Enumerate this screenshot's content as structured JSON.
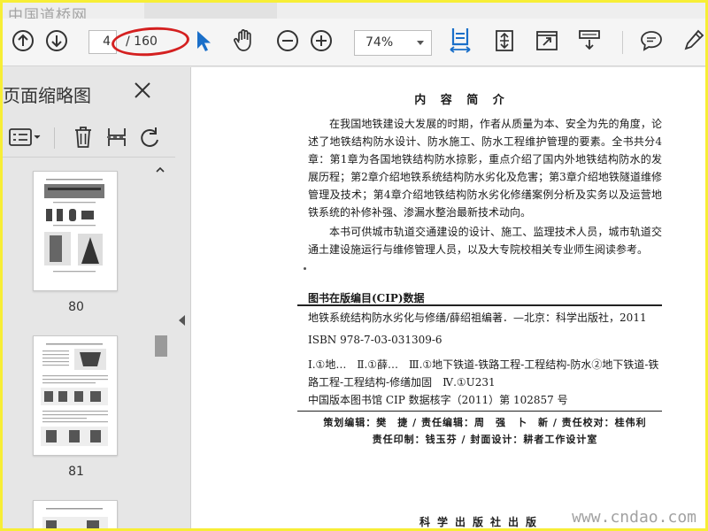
{
  "watermark_top": "中国道桥网",
  "watermark_bottom": "www.cndao.com",
  "toolbar": {
    "page_current": "4",
    "page_total": "/ 160",
    "zoom": "74%"
  },
  "sidebar": {
    "title": "页面缩略图",
    "thumbs": [
      {
        "label": "80"
      },
      {
        "label": "81"
      }
    ]
  },
  "doc": {
    "heading": "内 容 简 介",
    "intro_para_1": "在我国地铁建设大发展的时期，作者从质量为本、安全为先的角度，论述了地铁结构防水设计、防水施工、防水工程维护管理的要素。全书共分4章：第1章为各国地铁结构防水掠影，重点介绍了国内外地铁结构防水的发展历程；第2章介绍地铁系统结构防水劣化及危害；第3章介绍地铁隧道维修管理及技术；第4章介绍地铁结构防水劣化修缮案例分析及实务以及运营地铁系统的补修补强、渗漏水整治最新技术动向。",
    "intro_para_2": "本书可供城市轨道交通建设的设计、施工、监理技术人员，城市轨道交通土建设施运行与维修管理人员，以及大专院校相关专业师生阅读参考。",
    "cip_title": "图书在版编目(CIP)数据",
    "cip_book": "地铁系统结构防水劣化与修缮/薛绍祖编著．—北京：科学出版社，2011",
    "cip_isbn": "ISBN 978-7-03-031309-6",
    "cip_class": "Ⅰ.①地…　Ⅱ.①薛…　Ⅲ.①地下铁道-铁路工程-工程结构-防水②地下铁道-铁路工程-工程结构-修缮加固　Ⅳ.①U231",
    "cip_no": "中国版本图书馆 CIP 数据核字（2011）第 102857 号",
    "credits_1": "策划编辑：樊　捷 / 责任编辑：周　强　卜　新 / 责任校对：桂伟利",
    "credits_2": "责任印制：钱玉芬 / 封面设计：耕者工作设计室",
    "publisher": "科学出版社出版"
  },
  "colors": {
    "accent": "#1a6fc9",
    "annotation": "#d42020",
    "frame": "#f7ee36"
  }
}
